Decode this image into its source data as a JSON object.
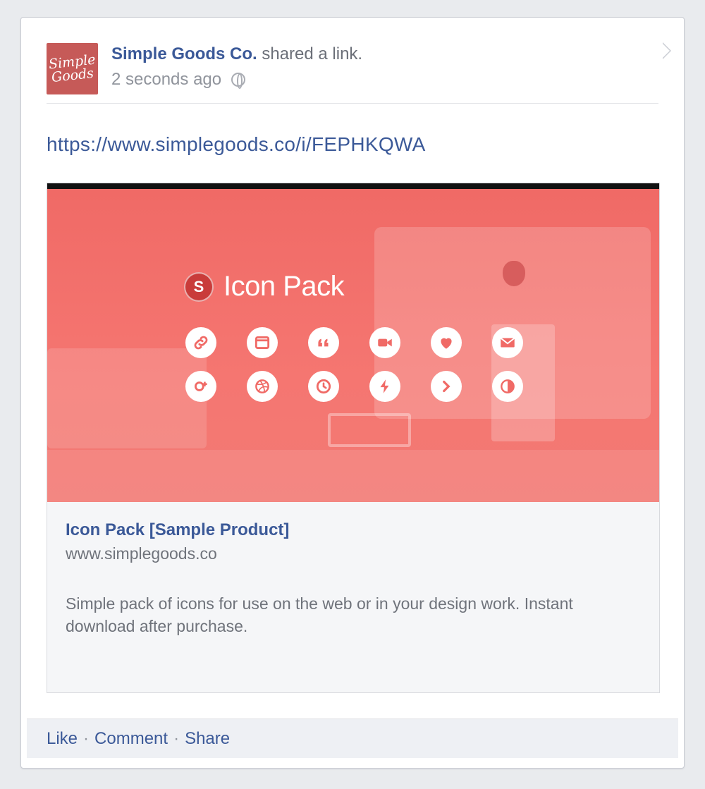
{
  "post": {
    "avatar_text_line1": "Simple",
    "avatar_text_line2": "Goods",
    "actor": "Simple Goods Co.",
    "verb": " shared a link.",
    "timestamp": "2 seconds ago",
    "privacy_icon": "globe-icon",
    "url": "https://www.simplegoods.co/i/FEPHKQWA"
  },
  "attachment": {
    "hero": {
      "brand_letter": "S",
      "brand_title": "Icon Pack",
      "icons": [
        "link-icon",
        "window-icon",
        "quote-icon",
        "video-icon",
        "heart-icon",
        "mail-icon",
        "google-plus-icon",
        "dribbble-icon",
        "clock-icon",
        "bolt-icon",
        "chevron-right-icon",
        "contrast-icon"
      ]
    },
    "title": "Icon Pack [Sample Product]",
    "domain": "www.simplegoods.co",
    "description": "Simple pack of icons for use on the web or in your design work. Instant download after purchase."
  },
  "actions": {
    "like": "Like",
    "comment": "Comment",
    "share": "Share",
    "separator": "·"
  },
  "colors": {
    "link_blue": "#3b5998",
    "hero_coral": "#f06a66",
    "avatar_red": "#c65a58"
  }
}
